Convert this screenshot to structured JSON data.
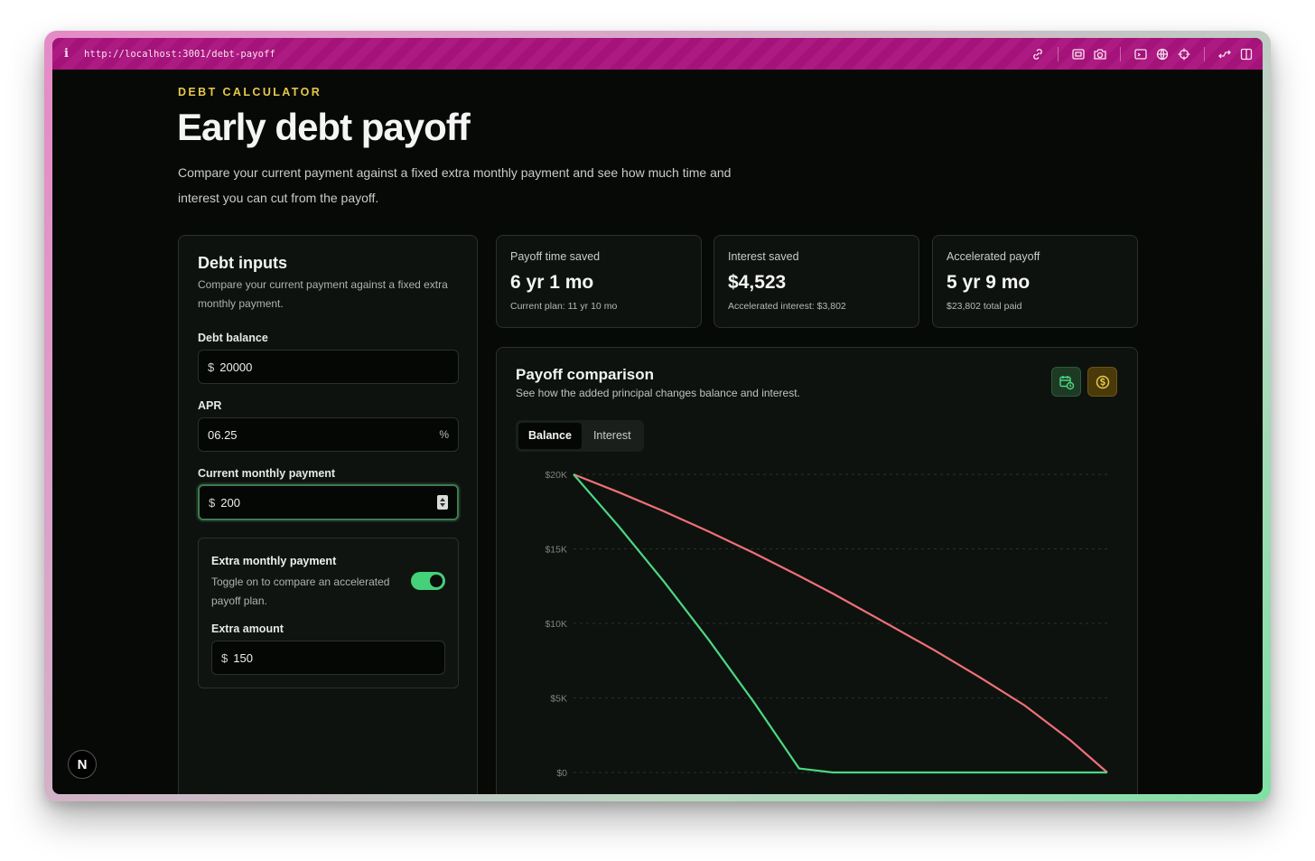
{
  "browser": {
    "info_glyph": "i",
    "url": "http://localhost:3001/debt-payoff"
  },
  "header": {
    "eyebrow": "DEBT CALCULATOR",
    "title": "Early debt payoff",
    "description": "Compare your current payment against a fixed extra monthly payment and see how much time and interest you can cut from the payoff."
  },
  "inputs": {
    "title": "Debt inputs",
    "subtitle": "Compare your current payment against a fixed extra monthly payment.",
    "balance": {
      "label": "Debt balance",
      "prefix": "$",
      "value": "20000"
    },
    "apr": {
      "label": "APR",
      "value": "06.25",
      "suffix": "%"
    },
    "payment": {
      "label": "Current monthly payment",
      "prefix": "$",
      "value": "200"
    },
    "extra": {
      "title": "Extra monthly payment",
      "subtitle": "Toggle on to compare an accelerated payoff plan.",
      "enabled": true,
      "amount_label": "Extra amount",
      "prefix": "$",
      "amount": "150"
    }
  },
  "stats": [
    {
      "label": "Payoff time saved",
      "value": "6 yr 1 mo",
      "note": "Current plan: 11 yr 10 mo"
    },
    {
      "label": "Interest saved",
      "value": "$4,523",
      "note": "Accelerated interest: $3,802"
    },
    {
      "label": "Accelerated payoff",
      "value": "5 yr 9 mo",
      "note": "$23,802 total paid"
    }
  ],
  "comparison": {
    "title": "Payoff comparison",
    "subtitle": "See how the added principal changes balance and interest.",
    "icons": [
      "calendar-clock-icon",
      "dollar-coin-icon"
    ],
    "tabs": [
      {
        "label": "Balance",
        "active": true
      },
      {
        "label": "Interest",
        "active": false
      }
    ]
  },
  "colors": {
    "current_plan": "#f07078",
    "accelerated_plan": "#4cd882",
    "accent": "#e6c84a"
  },
  "badge": {
    "letter": "N"
  },
  "chart_data": {
    "type": "line",
    "x": [
      0,
      12,
      24,
      36,
      48,
      60,
      69,
      84,
      96,
      108,
      120,
      132,
      142
    ],
    "ylim": [
      0,
      20000
    ],
    "y_ticks": [
      "$20K",
      "$15K",
      "$10K",
      "$5K",
      "$0"
    ],
    "y_tick_values": [
      20000,
      15000,
      10000,
      5000,
      0
    ],
    "grid": true,
    "series": [
      {
        "key": "current",
        "values": [
          20000,
          18800,
          17520,
          16160,
          14720,
          13190,
          12000,
          9900,
          8200,
          6400,
          4500,
          2200,
          0
        ]
      },
      {
        "key": "accelerated",
        "values": [
          20000,
          16520,
          12820,
          8890,
          4710,
          270,
          0,
          0,
          0,
          0,
          0,
          0,
          0
        ]
      }
    ]
  }
}
